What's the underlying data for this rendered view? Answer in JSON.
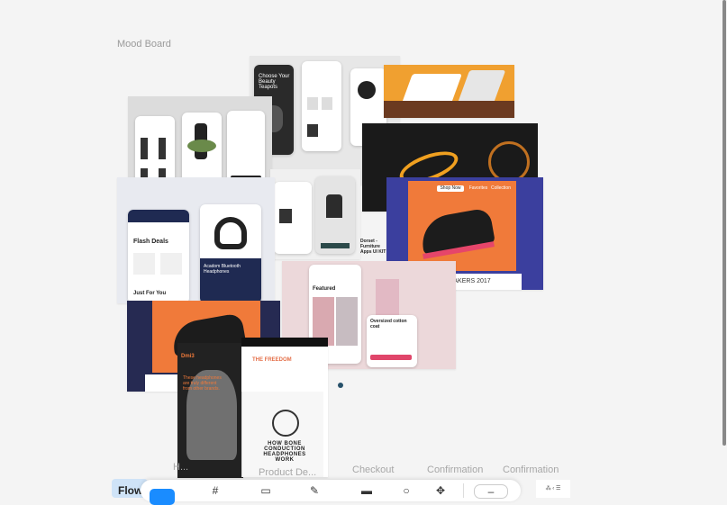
{
  "board": {
    "title": "Mood Board"
  },
  "bottom_labels": [
    "Confirmation",
    "Confirmation",
    "Checkout",
    "Product De...",
    "H..."
  ],
  "flow_tab": {
    "label": "Flow"
  },
  "cards": {
    "beauty": {
      "heading": "Choose Your Beauty Teapots"
    },
    "flash": {
      "heading": "Flash Deals",
      "sub": "Just For You"
    },
    "headphones": {
      "title": "Acadom Bluetooth Headphones"
    },
    "sneakers": {
      "title": "SNEAKERS 2017",
      "tab1": "Shop Now",
      "tab2": "Favorites",
      "tab3": "Collection"
    },
    "fashion": {
      "heading": "Featured",
      "title": "Oversized cotton coat"
    },
    "bone": {
      "title": "HOW BONE CONDUCTION HEADPHONES WORK",
      "banner": "THE FREEDOM"
    },
    "poster": {
      "quote": "These headphones are truly different from other brands."
    },
    "chair": {
      "title": "Dorset - Furniture Apps UI KIT"
    }
  },
  "toolbar": {
    "icons": [
      "select-icon",
      "frame-icon",
      "rectangle-icon",
      "pen-icon",
      "text-icon",
      "comment-icon",
      "plugins-icon",
      "share-icon"
    ]
  },
  "colors": {
    "orange": "#f07a3a",
    "dark": "#1c1c1c",
    "blue": "#3a7ef0",
    "pink": "#e9d5d8"
  }
}
